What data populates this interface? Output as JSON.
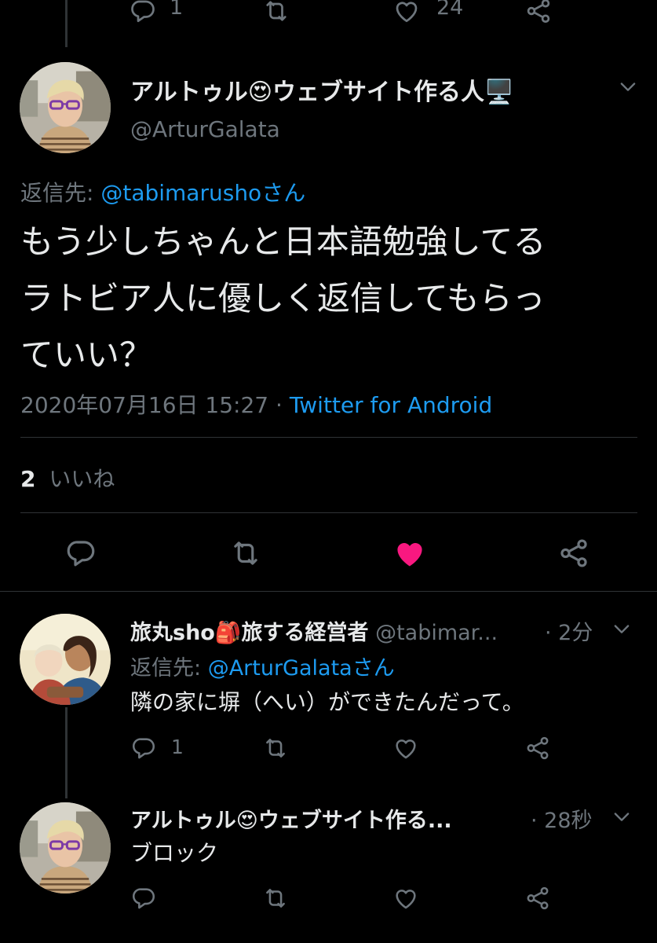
{
  "top_actions": {
    "reply_count": "1",
    "like_count": "24"
  },
  "main_tweet": {
    "display_name": "アルトゥル😍ウェブサイト作る人🖥️",
    "handle": "@ArturGalata",
    "reply_to_prefix": "返信先: ",
    "reply_to_handle": "@tabimarushoさん",
    "text_line1": "もう少しちゃんと日本語勉強してる",
    "text_line2": "ラトビア人に優しく返信してもらっ",
    "text_line3": "ていい？",
    "timestamp": "2020年07月16日 15:27 · ",
    "source": "Twitter for Android",
    "likes_count": "2",
    "likes_label": "いいね",
    "liked": true
  },
  "reply1": {
    "display_name": "旅丸sho🎒旅する経営者",
    "handle": "@tabimar...",
    "time": "· 2分",
    "reply_to_prefix": "返信先: ",
    "reply_to_handle": "@ArturGalataさん",
    "text": "隣の家に塀（へい）ができたんだって。",
    "reply_count": "1"
  },
  "reply2": {
    "display_name": "アルトゥル😍ウェブサイト作る...",
    "time": "· 28秒",
    "text": "ブロック"
  },
  "colors": {
    "background": "#000000",
    "accent": "#1d9bf0",
    "like": "#f91880",
    "muted": "#6e767d"
  }
}
